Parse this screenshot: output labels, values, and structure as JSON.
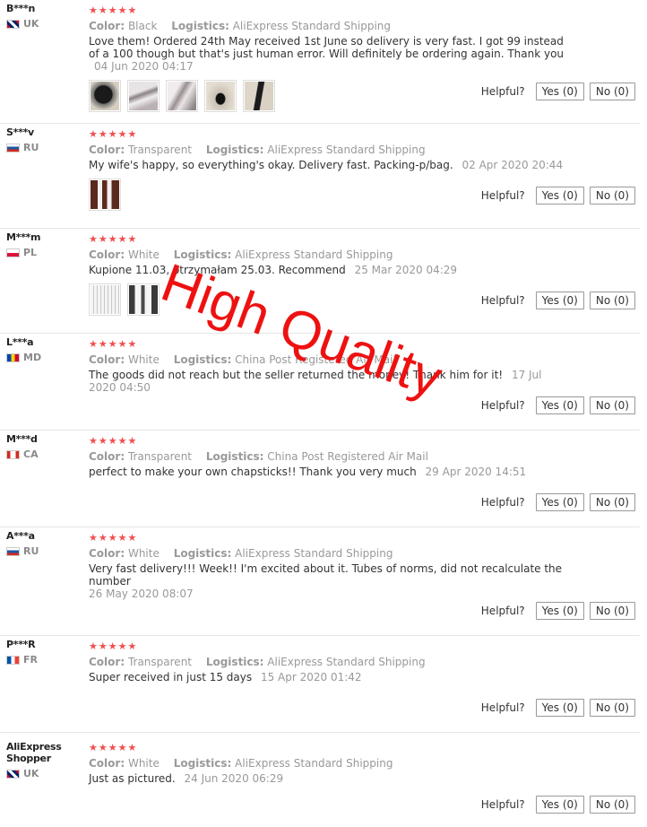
{
  "ui": {
    "color_key": "Color:",
    "logistics_key": "Logistics:",
    "helpful_label": "Helpful?",
    "stars": "★★★★★"
  },
  "watermark": "High Quality",
  "reviews": [
    {
      "user": "B***n",
      "country": "UK",
      "color": "Black",
      "logistics": "AliExpress Standard Shipping",
      "text": "Love them! Ordered 24th May received 1st June so delivery is very fast. I got 99 instead of a 100 though but that's just human error. Will definitely be ordering again. Thank you",
      "date": "04 Jun 2020 04:17",
      "yes": "Yes (0)",
      "no": "No (0)"
    },
    {
      "user": "S***v",
      "country": "RU",
      "color": "Transparent",
      "logistics": "AliExpress Standard Shipping",
      "text": "My wife's happy, so everything's okay. Delivery fast. Packing-p/bag.",
      "date": "02 Apr 2020 20:44",
      "yes": "Yes (0)",
      "no": "No (0)"
    },
    {
      "user": "M***m",
      "country": "PL",
      "color": "White",
      "logistics": "AliExpress Standard Shipping",
      "text": "Kupione 11.03, otrzymałam 25.03. Recommend",
      "date": "25 Mar 2020 04:29",
      "yes": "Yes (0)",
      "no": "No (0)"
    },
    {
      "user": "L***a",
      "country": "MD",
      "color": "White",
      "logistics": "China Post Registered Air Mail",
      "text": "The goods did not reach but the seller returned the money! Thank him for it!",
      "date": "17 Jul 2020 04:50",
      "yes": "Yes (0)",
      "no": "No (0)"
    },
    {
      "user": "M***d",
      "country": "CA",
      "color": "Transparent",
      "logistics": "China Post Registered Air Mail",
      "text": "perfect to make your own chapsticks!! Thank you very much",
      "date": "29 Apr 2020 14:51",
      "yes": "Yes (0)",
      "no": "No (0)"
    },
    {
      "user": "A***a",
      "country": "RU",
      "color": "White",
      "logistics": "AliExpress Standard Shipping",
      "text": "Very fast delivery!!! Week!! I'm excited about it. Tubes of norms, did not recalculate the number",
      "date": "26 May 2020 08:07",
      "yes": "Yes (0)",
      "no": "No (0)"
    },
    {
      "user": "P***R",
      "country": "FR",
      "color": "Transparent",
      "logistics": "AliExpress Standard Shipping",
      "text": "Super received in just 15 days",
      "date": "15 Apr 2020 01:42",
      "yes": "Yes (0)",
      "no": "No (0)"
    },
    {
      "user": "AliExpress Shopper",
      "country": "UK",
      "color": "White",
      "logistics": "AliExpress Standard Shipping",
      "text": "Just as pictured.",
      "date": "24 Jun 2020 06:29",
      "yes": "Yes (0)",
      "no": "No (0)"
    }
  ]
}
